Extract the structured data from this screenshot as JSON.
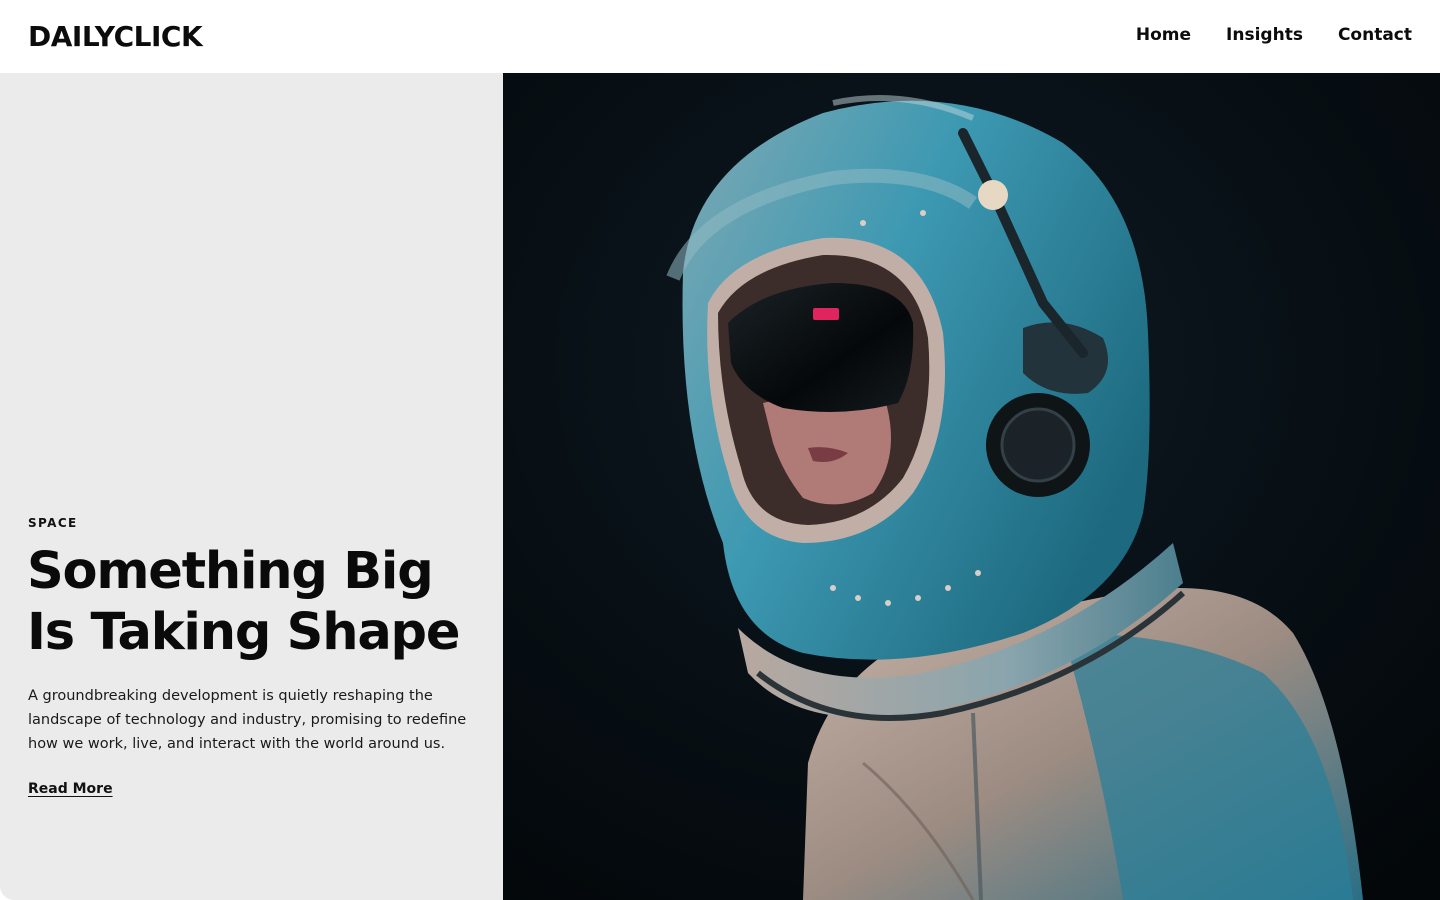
{
  "header": {
    "logo": "DAILYCLICK",
    "nav": [
      {
        "label": "Home"
      },
      {
        "label": "Insights"
      },
      {
        "label": "Contact"
      }
    ]
  },
  "feature": {
    "category": "SPACE",
    "headline_line1": "Something Big",
    "headline_line2": "Is Taking Shape",
    "excerpt": "A groundbreaking development is quietly reshaping the landscape of technology and industry, promising to redefine how we work, live, and interact with the world around us.",
    "read_more": "Read More"
  },
  "colors": {
    "panel_bg": "#ebebeb",
    "hero_bg": "#05090c",
    "helmet_teal": "#2f8fa6",
    "suit_beige": "#b9a89a",
    "visor_accent": "#e0245e"
  }
}
